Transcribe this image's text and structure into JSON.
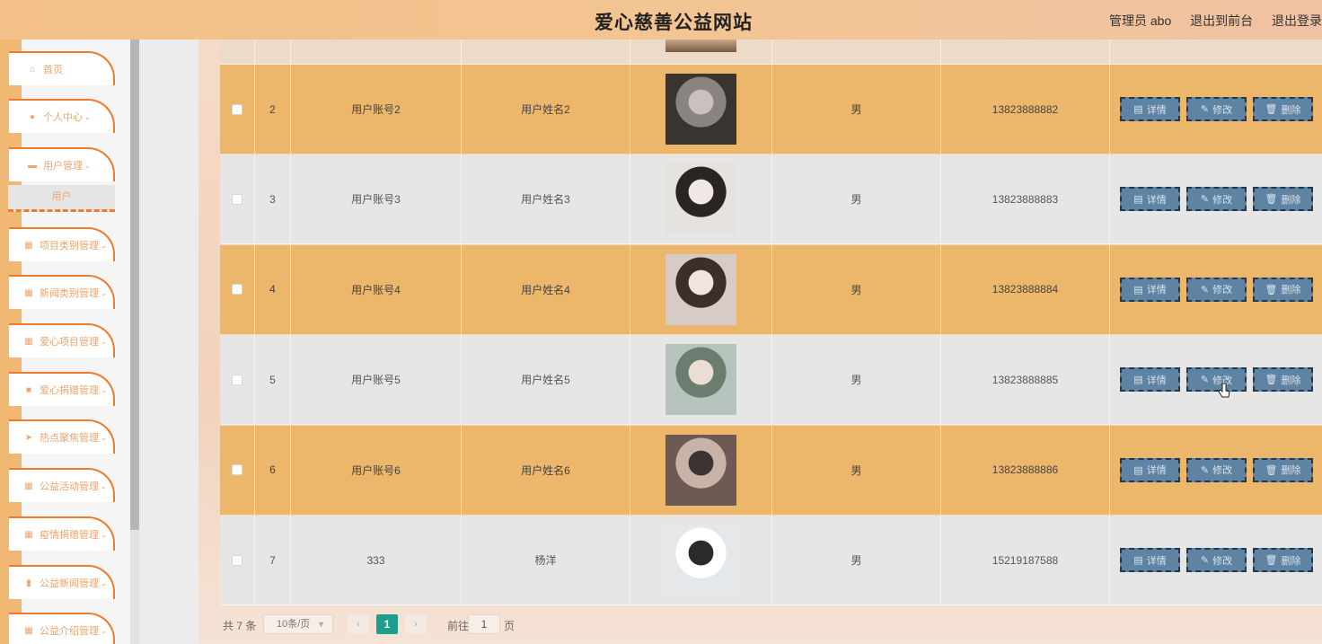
{
  "header": {
    "title": "爱心慈善公益网站",
    "admin_label": "管理员 abo",
    "to_front": "退出到前台",
    "logout": "退出登录"
  },
  "sidebar": {
    "items": [
      {
        "label": "首页",
        "icon": "home-icon",
        "glyph": "⌂",
        "has_chevron": false
      },
      {
        "label": "个人中心",
        "icon": "user-icon",
        "glyph": "●",
        "has_chevron": true
      },
      {
        "label": "用户管理",
        "icon": "chat-icon",
        "glyph": "▬",
        "has_chevron": true
      },
      {
        "label": "项目类别管理",
        "icon": "grid-icon",
        "glyph": "▦",
        "has_chevron": true
      },
      {
        "label": "新闻类别管理",
        "icon": "grid-icon",
        "glyph": "▦",
        "has_chevron": true
      },
      {
        "label": "爱心项目管理",
        "icon": "grid-icon",
        "glyph": "▦",
        "has_chevron": true
      },
      {
        "label": "爱心捐赠管理",
        "icon": "box-icon",
        "glyph": "■",
        "has_chevron": true
      },
      {
        "label": "热点聚焦管理",
        "icon": "send-icon",
        "glyph": "➤",
        "has_chevron": true
      },
      {
        "label": "公益活动管理",
        "icon": "grid-icon",
        "glyph": "▦",
        "has_chevron": true
      },
      {
        "label": "疫情捐赠管理",
        "icon": "grid-icon",
        "glyph": "▦",
        "has_chevron": true
      },
      {
        "label": "公益新闻管理",
        "icon": "bar-chart-icon",
        "glyph": "▮",
        "has_chevron": true
      },
      {
        "label": "公益介绍管理",
        "icon": "grid-icon",
        "glyph": "▦",
        "has_chevron": true
      }
    ],
    "submenu_label": "用户"
  },
  "table": {
    "rows": [
      {
        "index": "2",
        "account": "用户账号2",
        "name": "用户姓名2",
        "gender": "男",
        "phone": "13823888882",
        "checked": false
      },
      {
        "index": "3",
        "account": "用户账号3",
        "name": "用户姓名3",
        "gender": "男",
        "phone": "13823888883",
        "checked": false
      },
      {
        "index": "4",
        "account": "用户账号4",
        "name": "用户姓名4",
        "gender": "男",
        "phone": "13823888884",
        "checked": false
      },
      {
        "index": "5",
        "account": "用户账号5",
        "name": "用户姓名5",
        "gender": "男",
        "phone": "13823888885",
        "checked": false
      },
      {
        "index": "6",
        "account": "用户账号6",
        "name": "用户姓名6",
        "gender": "男",
        "phone": "13823888886",
        "checked": false
      },
      {
        "index": "7",
        "account": "333",
        "name": "杨洋",
        "gender": "男",
        "phone": "15219187588",
        "checked": false
      }
    ],
    "actions": {
      "detail": "详情",
      "edit": "修改",
      "delete": "删除"
    }
  },
  "pagination": {
    "total": "共 7 条",
    "page_size": "10条/页",
    "current_page": "1",
    "goto_label": "前往",
    "goto_value": "1",
    "page_suffix": "页"
  },
  "colors": {
    "accent_orange": "#ef7a2a",
    "row_orange": "#ecb66b",
    "row_gray": "#e6e6e6",
    "button_blue": "#5f83a2",
    "page_active": "#1c9e8c"
  }
}
